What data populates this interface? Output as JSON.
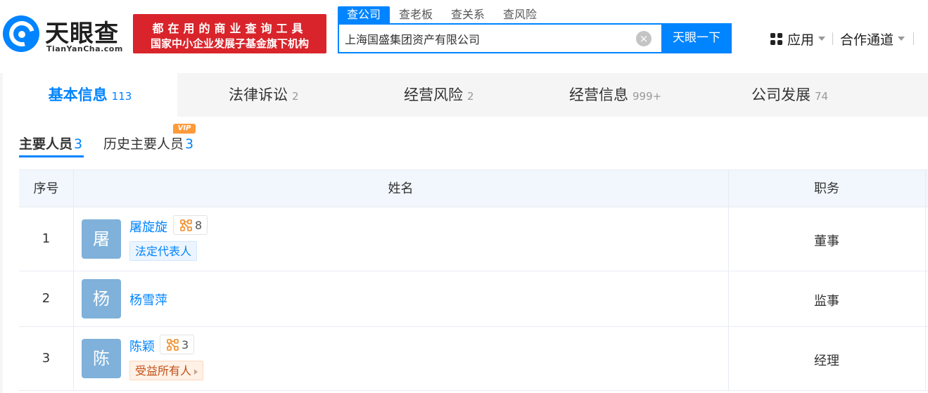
{
  "header": {
    "logo_title": "天眼查",
    "logo_sub": "TianYanCha.com",
    "promo_line1": "都在用的商业查询工具",
    "promo_line2": "国家中小企业发展子基金旗下机构",
    "search_tabs": [
      "查公司",
      "查老板",
      "查关系",
      "查风险"
    ],
    "search_value": "上海国盛集团资产有限公司",
    "search_button": "天眼一下",
    "nav_app": "应用",
    "nav_partner": "合作通道"
  },
  "main_tabs": [
    {
      "label": "基本信息",
      "count": "113"
    },
    {
      "label": "法律诉讼",
      "count": "2"
    },
    {
      "label": "经营风险",
      "count": "2"
    },
    {
      "label": "经营信息",
      "count": "999+"
    },
    {
      "label": "公司发展",
      "count": "74"
    }
  ],
  "sub_tabs": [
    {
      "label": "主要人员",
      "count": "3"
    },
    {
      "label": "历史主要人员",
      "count": "3",
      "badge": "VIP"
    }
  ],
  "table": {
    "headers": {
      "index": "序号",
      "name": "姓名",
      "role": "职务"
    },
    "rows": [
      {
        "index": "1",
        "avatar": "屠",
        "name": "屠旋旋",
        "relations": "8",
        "tag": "法定代表人",
        "role": "董事"
      },
      {
        "index": "2",
        "avatar": "杨",
        "name": "杨雪萍",
        "role": "监事"
      },
      {
        "index": "3",
        "avatar": "陈",
        "name": "陈颖",
        "relations": "3",
        "tag": "受益所有人",
        "role": "经理"
      }
    ]
  },
  "colors": {
    "accent": "#0084ff",
    "promo_red": "#d9242b",
    "avatar_bg": "#7fb1da",
    "vip": "#ff9a3c"
  }
}
